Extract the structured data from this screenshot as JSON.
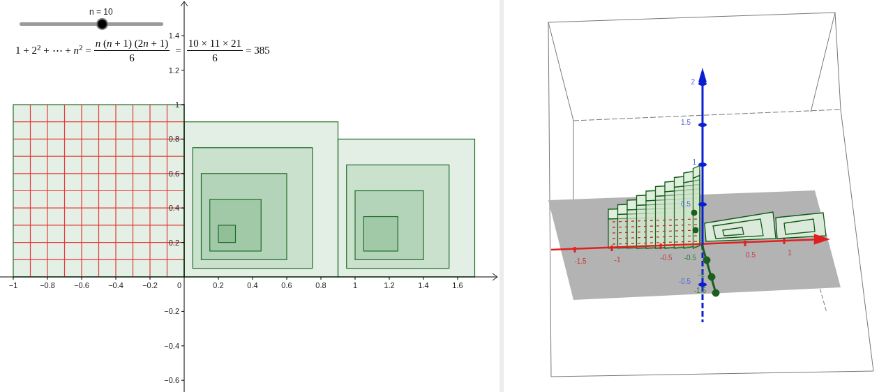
{
  "slider": {
    "label": "n = 10",
    "level": 0.575
  },
  "formula": {
    "lhs": "1 + 2$^{2}$ + ⋯ + *n*$^{2}$ =",
    "fraction_1": {
      "numerator": [
        {
          "kind": "variable",
          "text": "n"
        },
        {
          "kind": "plain",
          "text": " ("
        },
        {
          "kind": "variable",
          "text": "n"
        },
        {
          "kind": "plain",
          "text": " + 1) (2"
        },
        {
          "kind": "variable",
          "text": "n"
        },
        {
          "kind": "plain",
          "text": " + 1)"
        }
      ],
      "denominator": "6"
    },
    "equals": "=",
    "fraction_2": {
      "numerator": "10 × 11 × 21",
      "denominator": "6"
    },
    "result": "= 385"
  },
  "graphics_2d": {
    "x_ticks": [
      "−1",
      "−0.8",
      "−0.6",
      "−0.4",
      "−0.2",
      "0",
      "0.2",
      "0.4",
      "0.6",
      "0.8",
      "1",
      "1.2",
      "1.4",
      "1.6"
    ],
    "y_ticks": [
      "1.4",
      "1.2",
      "1",
      "0.8",
      "0.6",
      "0.4",
      "0.2",
      "−0.2",
      "−0.4",
      "−0.6"
    ]
  },
  "graphics_3d": {
    "x_labels": [
      "-1.5",
      "-1",
      "-0.5",
      "0.5",
      "1"
    ],
    "y_labels": [
      "-0.5",
      "-1",
      "-1.5"
    ],
    "z_labels": [
      "2",
      "1.5",
      "1",
      "0.5",
      "-0.5"
    ]
  }
}
